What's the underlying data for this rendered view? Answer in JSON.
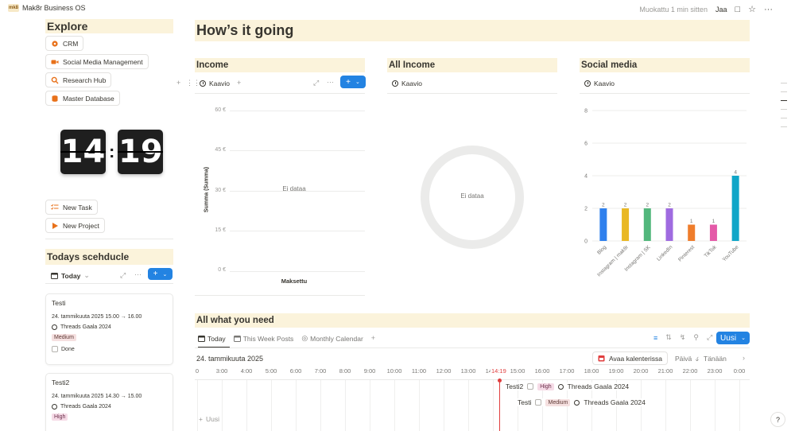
{
  "topbar": {
    "logo_text": "mk8",
    "app_title": "Mak8r Business OS",
    "edited": "Muokattu 1 min sitten",
    "share": "Jaa"
  },
  "sidebar": {
    "explore_title": "Explore",
    "links": [
      {
        "label": "CRM",
        "icon": "gear-icon",
        "color": "#e8711a"
      },
      {
        "label": "Social Media Management",
        "icon": "video-icon",
        "color": "#e8711a"
      },
      {
        "label": "Research Hub",
        "icon": "search-icon",
        "color": "#e8711a"
      },
      {
        "label": "Master Database",
        "icon": "database-icon",
        "color": "#e8711a"
      }
    ],
    "clock": {
      "hours": "14",
      "minutes": "19"
    },
    "actions": [
      {
        "label": "New Task",
        "icon": "checklist-icon"
      },
      {
        "label": "New Project",
        "icon": "play-icon"
      }
    ],
    "schedule_title": "Todays scehducle",
    "schedule_view": "Today",
    "cards": [
      {
        "title": "Testi",
        "date": "24. tammikuuta 2025 15.00 → 16.00",
        "project": "Threads Gaala 2024",
        "priority": "Medium",
        "done_label": "Done"
      },
      {
        "title": "Testi2",
        "date": "24. tammikuuta 2025 14.30 → 15.00",
        "project": "Threads Gaala 2024",
        "priority": "High"
      }
    ]
  },
  "main": {
    "title": "How’s it going",
    "income": {
      "title": "Income",
      "view": "Kaavio",
      "ylabel": "Summa (Summa)",
      "xlabel": "Maksettu",
      "yticks": [
        "60 €",
        "45 €",
        "30 €",
        "15 €",
        "0 €"
      ],
      "empty": "Ei dataa"
    },
    "all_income": {
      "title": "All Income",
      "view": "Kaavio",
      "empty": "Ei dataa"
    },
    "social": {
      "title": "Social media",
      "view": "Kaavio"
    },
    "all_need": {
      "title": "All what you need",
      "tabs": [
        "Today",
        "This Week Posts",
        "Monthly Calendar"
      ],
      "new_button": "Uusi",
      "date_label": "24. tammikuuta 2025",
      "open_calendar": "Avaa kalenterissa",
      "day_select": "Päivä",
      "today_button": "Tänään",
      "now_marker": "14:19",
      "hours": [
        "0",
        "3:00",
        "4:00",
        "5:00",
        "6:00",
        "7:00",
        "8:00",
        "9:00",
        "10:00",
        "11:00",
        "12:00",
        "13:00",
        "14:00",
        "15:00",
        "16:00",
        "17:00",
        "18:00",
        "19:00",
        "20:00",
        "21:00",
        "22:00",
        "23:00",
        "0:00"
      ],
      "events": [
        {
          "title": "Testi2",
          "priority": "High",
          "project": "Threads Gaala 2024"
        },
        {
          "title": "Testi",
          "priority": "Medium",
          "project": "Threads Gaala 2024"
        }
      ],
      "add_new": "Uusi"
    }
  },
  "chart_data": {
    "type": "bar",
    "categories": [
      "Blog",
      "Instagram | mak8r",
      "Instagram | SK",
      "LinkedIn",
      "Pinterest",
      "TikTok",
      "YouTube"
    ],
    "values": [
      2,
      2,
      2,
      2,
      1,
      1,
      4
    ],
    "colors": [
      "#2f80ed",
      "#e9b824",
      "#52b77c",
      "#9f6be0",
      "#ef7d2c",
      "#e45aa8",
      "#10a6c8"
    ],
    "yticks": [
      0,
      2,
      4,
      6,
      8
    ],
    "ylim": [
      0,
      8
    ],
    "grid": true
  }
}
